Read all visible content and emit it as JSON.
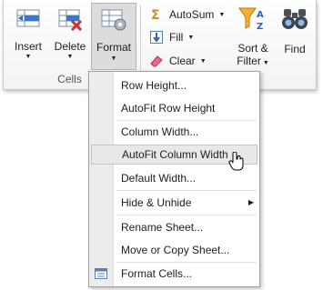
{
  "colors": {
    "ribbon_bg": "#f3f3f3",
    "menu_highlight": "#e8e8e8",
    "accent_blue": "#3a78c8"
  },
  "ribbon": {
    "cells_group": {
      "label": "Cells",
      "buttons": [
        {
          "label": "Insert",
          "icon": "insert-rows-icon",
          "arrow": "▼"
        },
        {
          "label": "Delete",
          "icon": "delete-rows-icon",
          "arrow": "▼"
        },
        {
          "label": "Format",
          "icon": "format-cells-icon",
          "arrow": "▼"
        }
      ]
    },
    "editing_group": {
      "small": [
        {
          "label": "AutoSum",
          "icon": "sigma-icon",
          "arrow": "▼"
        },
        {
          "label": "Fill",
          "icon": "fill-down-icon",
          "arrow": "▼"
        },
        {
          "label": "Clear",
          "icon": "eraser-icon",
          "arrow": "▼"
        }
      ],
      "sort": {
        "line1": "Sort &",
        "line2": "Filter",
        "arrow": "▼",
        "icon": "sort-filter-icon"
      },
      "find": {
        "label": "Find",
        "icon": "binoculars-icon"
      }
    }
  },
  "menu": {
    "items": [
      {
        "label": "Row Height..."
      },
      {
        "label": "AutoFit Row Height"
      },
      {
        "label": "Column Width..."
      },
      {
        "label": "AutoFit Column Width"
      },
      {
        "label": "Default Width..."
      },
      {
        "label": "Hide & Unhide",
        "submenu": "▶"
      },
      {
        "label": "Rename Sheet..."
      },
      {
        "label": "Move or Copy Sheet..."
      },
      {
        "label": "Format Cells...",
        "icon": "format-cells-small-icon"
      }
    ]
  }
}
